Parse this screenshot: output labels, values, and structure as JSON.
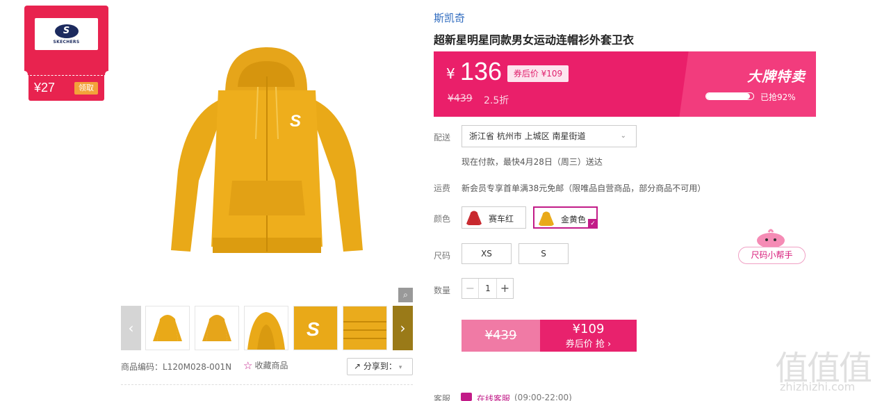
{
  "coupon": {
    "brand_text": "SKECHERS",
    "amount": "¥27",
    "claim_label": "领取"
  },
  "product": {
    "brand": "斯凯奇",
    "title": "超新星明星同款男女运动连帽衫外套卫衣",
    "sku_code": "商品编码：L120M028-001N",
    "favorite_label": "收藏商品",
    "share_label": "分享到："
  },
  "price": {
    "yen": "¥",
    "current": "136",
    "coupon_price_tag": "券后价 ¥109",
    "original": "¥439",
    "discount": "2.5折",
    "event_title": "大牌特卖",
    "sold_text": "已抢92%",
    "sold_fraction": 0.92
  },
  "delivery": {
    "label": "配送",
    "address": "浙江省 杭州市 上城区 南星街道",
    "eta": "现在付款，最快4月28日（周三）送达"
  },
  "shipping": {
    "label": "运费",
    "note": "新会员专享首单满38元免邮（限唯品自营商品，部分商品不可用）"
  },
  "colors": {
    "label": "颜色",
    "options": [
      {
        "label": "赛车红",
        "swatch": "#c8282e",
        "selected": false
      },
      {
        "label": "金黄色",
        "swatch": "#e9a918",
        "selected": true
      }
    ]
  },
  "sizes": {
    "label": "尺码",
    "options": [
      "XS",
      "S"
    ],
    "helper_label": "尺码小帮手"
  },
  "quantity": {
    "label": "数量",
    "value": "1"
  },
  "buy": {
    "original_price": "¥439",
    "coupon_price": "¥109",
    "coupon_action": "券后价 抢 ›"
  },
  "service": {
    "label": "客服",
    "link": "在线客服",
    "hours": "(09:00-22:00)"
  },
  "watermark": {
    "glyphs": "值值值",
    "site": "zhizhizhi.com"
  },
  "colors_theme": {
    "accent": "#e8226d",
    "link": "#2f6bbf",
    "purple": "#c21b88",
    "product_yellow": "#e9a918"
  }
}
